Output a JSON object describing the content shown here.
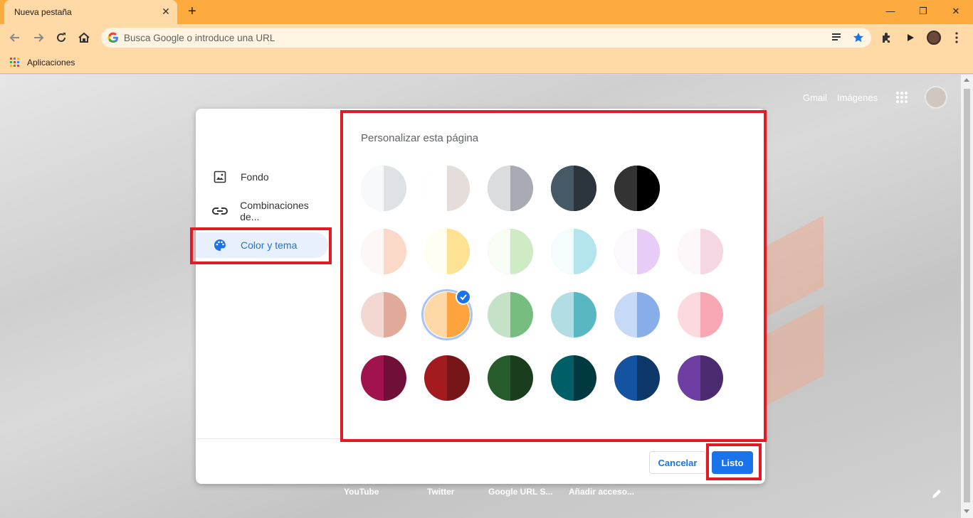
{
  "browser": {
    "tab_title": "Nueva pestaña",
    "omnibox_placeholder": "Busca Google o introduce una URL",
    "bookmark_apps_label": "Aplicaciones"
  },
  "ntp": {
    "gmail": "Gmail",
    "images": "Imágenes",
    "shortcuts": [
      "YouTube",
      "Twitter",
      "Google URL S...",
      "Añadir acceso..."
    ]
  },
  "dialog": {
    "title": "Personalizar esta página",
    "nav": [
      {
        "label": "Fondo",
        "icon": "image-icon"
      },
      {
        "label": "Combinaciones de...",
        "icon": "link-icon"
      },
      {
        "label": "Color y tema",
        "icon": "palette-icon",
        "active": true
      }
    ],
    "cancel_label": "Cancelar",
    "done_label": "Listo",
    "swatch_rows": [
      [
        [
          "#f8f9fa",
          "#dee1e6"
        ],
        [
          "#ffffff",
          "#e5ddda"
        ],
        [
          "#dadce0",
          "#a8abb4"
        ],
        [
          "#455a64",
          "#2b353b"
        ],
        [
          "#333333",
          "#000000"
        ]
      ],
      [
        [
          "#fdf8f6",
          "#fbd9c9"
        ],
        [
          "#fffef3",
          "#fde293"
        ],
        [
          "#f7fcf4",
          "#cfebc6"
        ],
        [
          "#f4fcfd",
          "#b4e4ee"
        ],
        [
          "#fbf8fe",
          "#e6ccf7"
        ],
        [
          "#fdf7fa",
          "#f5d6e3"
        ]
      ],
      [
        [
          "#f2d8d1",
          "#e0a99a"
        ],
        [
          "#ffd8a8",
          "#fea43e"
        ],
        [
          "#c3e2c6",
          "#78bd80"
        ],
        [
          "#b1dde3",
          "#58b7c0"
        ],
        [
          "#c6d9f7",
          "#88aee9"
        ],
        [
          "#fcd9df",
          "#f8a8b5"
        ]
      ],
      [
        [
          "#a0134c",
          "#700f38"
        ],
        [
          "#a31b1f",
          "#761618"
        ],
        [
          "#265c2c",
          "#1a3d1d"
        ],
        [
          "#005e67",
          "#003a40"
        ],
        [
          "#1353a0",
          "#0d3869"
        ],
        [
          "#6e3ea3",
          "#4b2a70"
        ]
      ]
    ],
    "selected_swatch": {
      "row": 2,
      "col": 1
    }
  },
  "colors": {
    "accent": "#1a73e8",
    "highlight": "#e11b24",
    "frame": "#fdaa3e"
  }
}
